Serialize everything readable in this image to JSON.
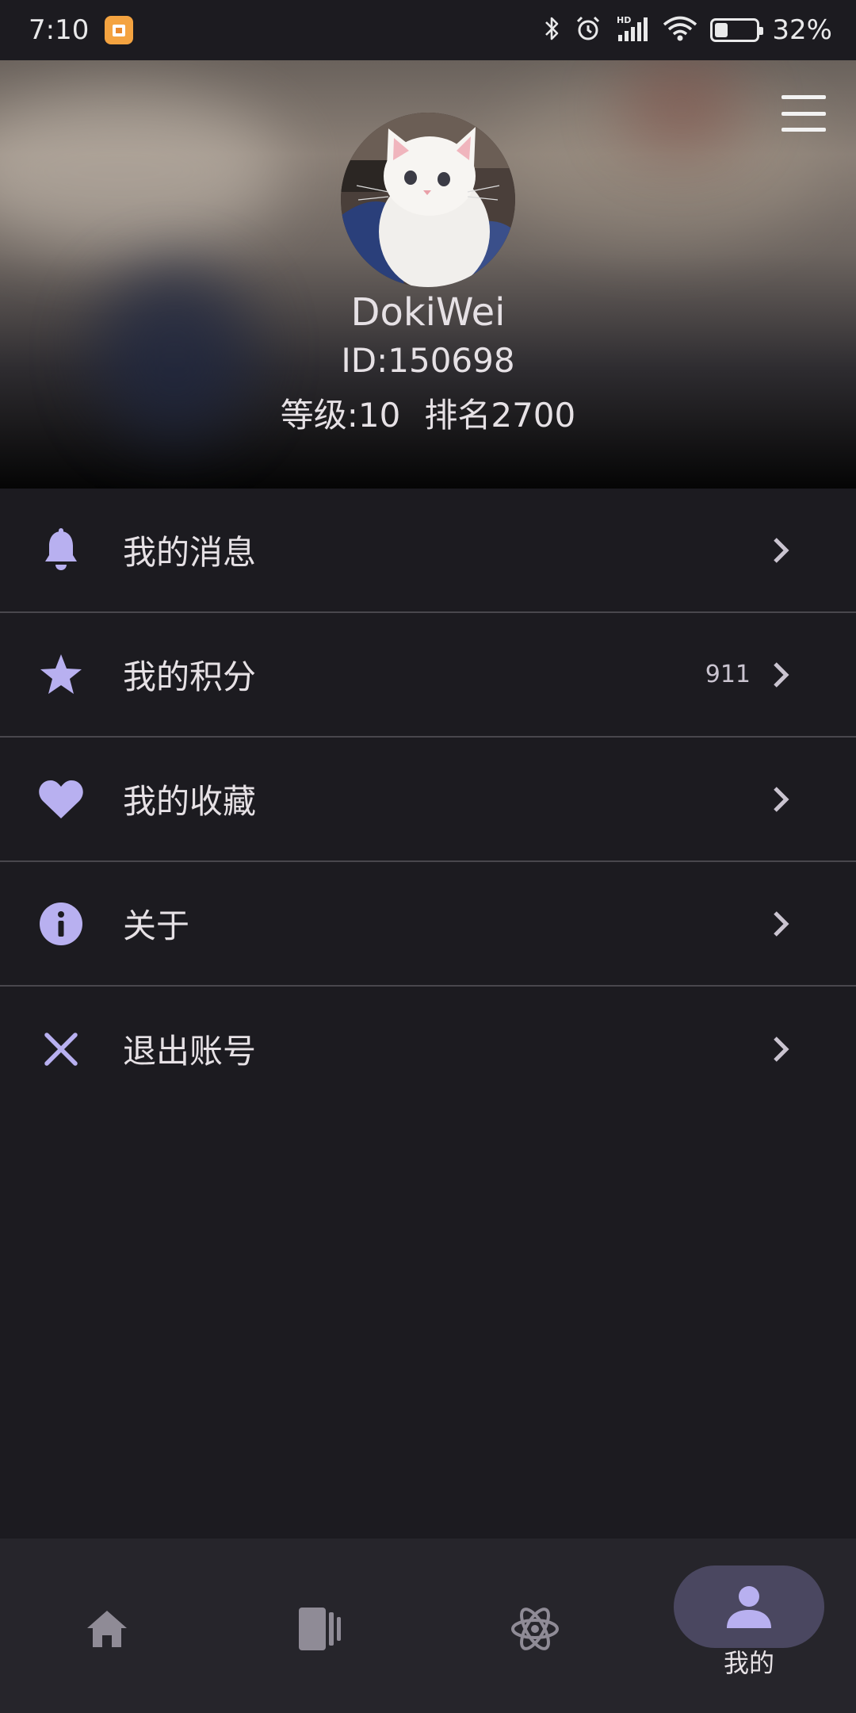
{
  "status_bar": {
    "time": "7:10",
    "battery_percent": "32%",
    "battery_level": 0.32,
    "icons": [
      "bluetooth-icon",
      "alarm-icon",
      "hd-signal-icon",
      "wifi-icon",
      "battery-icon"
    ]
  },
  "profile": {
    "username": "DokiWei",
    "id_text": "ID:150698",
    "level_text": "等级:10",
    "rank_text": "排名2700",
    "avatar": "white-kitten-photo"
  },
  "menu": {
    "items": [
      {
        "label": "我的消息",
        "icon": "bell-icon",
        "value": ""
      },
      {
        "label": "我的积分",
        "icon": "star-icon",
        "value": "911"
      },
      {
        "label": "我的收藏",
        "icon": "heart-icon",
        "value": ""
      },
      {
        "label": "关于",
        "icon": "info-icon",
        "value": ""
      },
      {
        "label": "退出账号",
        "icon": "close-icon",
        "value": ""
      }
    ]
  },
  "bottom_nav": {
    "items": [
      {
        "icon": "home-icon",
        "label": ""
      },
      {
        "icon": "cards-icon",
        "label": ""
      },
      {
        "icon": "atom-icon",
        "label": ""
      },
      {
        "icon": "person-icon",
        "label": "我的",
        "active": true
      }
    ]
  },
  "colors": {
    "accent": "#b8b0f0",
    "background": "#1c1b20",
    "nav_background": "#26252b",
    "nav_active_pill": "#4a4760"
  }
}
